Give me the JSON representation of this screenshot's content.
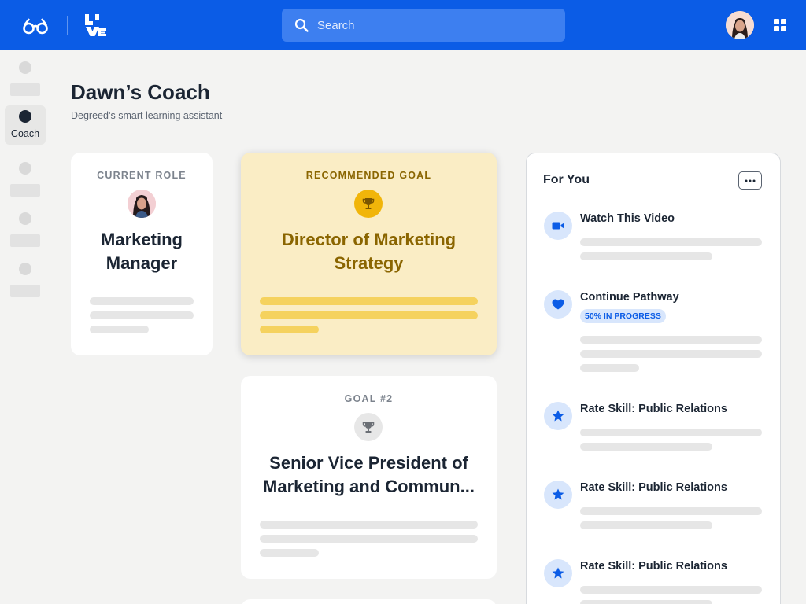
{
  "header": {
    "search_placeholder": "Search",
    "brand_color": "#0b5ce6"
  },
  "sidebar": {
    "items": [
      {
        "label": ""
      },
      {
        "label": "Coach",
        "active": true
      },
      {
        "label": ""
      },
      {
        "label": ""
      },
      {
        "label": ""
      }
    ]
  },
  "page": {
    "title": "Dawn’s Coach",
    "subtitle": "Degreed’s smart learning assistant"
  },
  "current_role": {
    "eyebrow": "CURRENT ROLE",
    "title": "Marketing Manager"
  },
  "recommended_goal": {
    "eyebrow": "RECOMMENDED GOAL",
    "title": "Director of Marketing Strategy",
    "accent_color": "#8a6500",
    "background_color": "#faedc5"
  },
  "goal_2": {
    "eyebrow": "GOAL #2",
    "title": "Senior Vice President of Marketing and Commun..."
  },
  "for_you": {
    "title": "For You",
    "items": [
      {
        "icon": "video-icon",
        "title": "Watch This Video"
      },
      {
        "icon": "heart-icon",
        "title": "Continue Pathway",
        "badge": "50% IN PROGRESS"
      },
      {
        "icon": "star-icon",
        "title": "Rate Skill: Public Relations"
      },
      {
        "icon": "star-icon",
        "title": "Rate Skill: Public Relations"
      },
      {
        "icon": "star-icon",
        "title": "Rate Skill: Public Relations"
      }
    ]
  }
}
